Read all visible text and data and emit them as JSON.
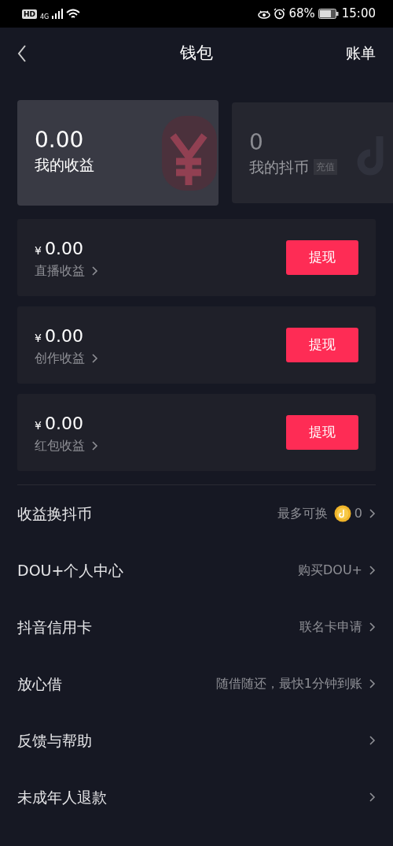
{
  "status_bar": {
    "hd": "HD",
    "network": "4G",
    "battery": "68%",
    "time": "15:00"
  },
  "header": {
    "title": "钱包",
    "action": "账单"
  },
  "summary_cards": [
    {
      "kind": "earnings",
      "value": "0.00",
      "label": "我的收益",
      "selected": true
    },
    {
      "kind": "coins",
      "value": "0",
      "label": "我的抖币",
      "tag": "充值",
      "selected": false
    }
  ],
  "earnings": [
    {
      "currency": "¥",
      "amount": "0.00",
      "label": "直播收益",
      "button": "提现"
    },
    {
      "currency": "¥",
      "amount": "0.00",
      "label": "创作收益",
      "button": "提现"
    },
    {
      "currency": "¥",
      "amount": "0.00",
      "label": "红包收益",
      "button": "提现"
    }
  ],
  "menu": [
    {
      "label": "收益换抖币",
      "detail": "最多可换",
      "coin_value": "0"
    },
    {
      "label": "DOU+个人中心",
      "detail": "购买DOU+"
    },
    {
      "label": "抖音信用卡",
      "detail": "联名卡申请"
    },
    {
      "label": "放心借",
      "detail": "随借随还，最快1分钟到账"
    },
    {
      "label": "反馈与帮助"
    },
    {
      "label": "未成年人退款"
    }
  ]
}
